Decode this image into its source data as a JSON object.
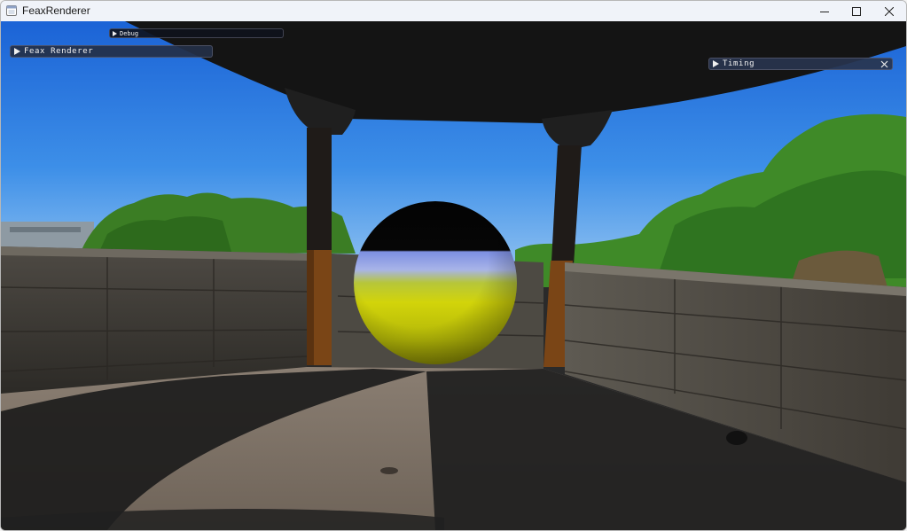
{
  "window": {
    "title": "FeaxRenderer",
    "controls": {
      "minimize": "minimize-icon",
      "maximize": "maximize-icon",
      "close": "close-icon"
    }
  },
  "panels": {
    "debug": {
      "label": "Debug",
      "collapsed": true
    },
    "main": {
      "label": "Feax Renderer",
      "collapsed": true
    },
    "timing": {
      "label": "Timing",
      "collapsed": true,
      "has_close": true
    }
  },
  "scene": {
    "sphere_colors": {
      "top": "#050505",
      "band": "#8a9ee8",
      "bottom": "#cfcf10"
    },
    "sky_color": "#2f7fe3",
    "foliage_color": "#3f8f2a"
  }
}
